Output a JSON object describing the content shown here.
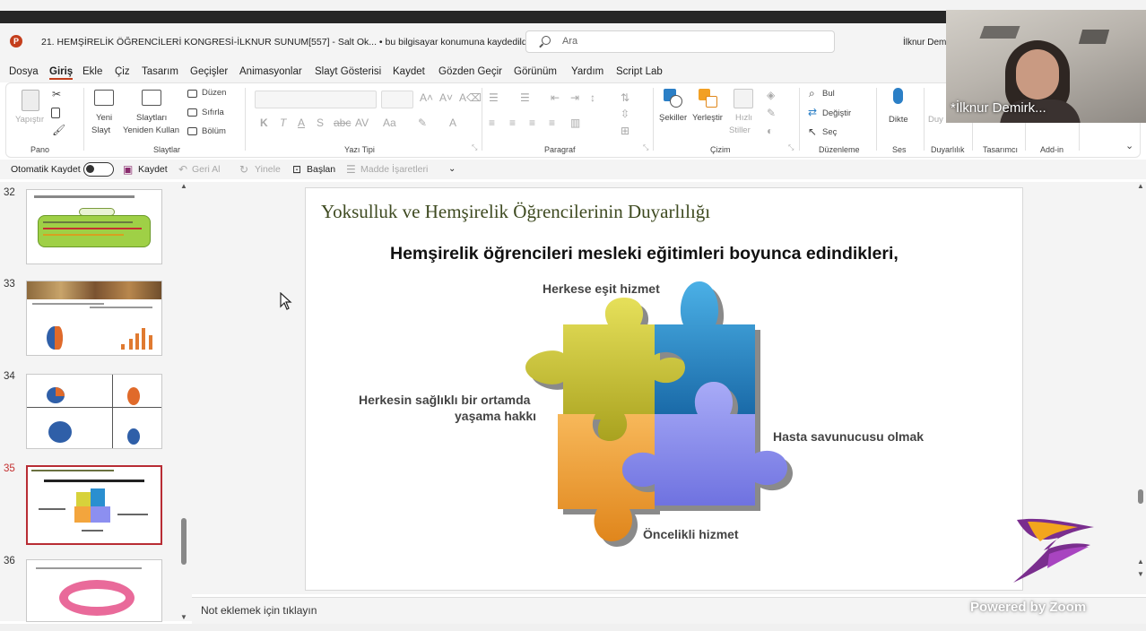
{
  "window": {
    "title": "21. HEMŞİRELİK ÖĞRENCİLERİ KONGRESİ-İLKNUR SUNUM[557]  -  Salt Ok...  •  bu bilgisayar konumuna kaydedildi",
    "search_placeholder": "Ara",
    "user": "İlknur Dem"
  },
  "menu": [
    "Dosya",
    "Giriş",
    "Ekle",
    "Çiz",
    "Tasarım",
    "Geçişler",
    "Animasyonlar",
    "Slayt Gösterisi",
    "Kaydet",
    "Gözden Geçir",
    "Görünüm",
    "Yardım",
    "Script Lab"
  ],
  "ribbon": {
    "groups": [
      "Pano",
      "Slaytlar",
      "Yazı Tipi",
      "Paragraf",
      "Çizim",
      "Düzenleme",
      "Ses",
      "Duyarlılık",
      "Tasarımcı",
      "Add-in"
    ],
    "paste": "Yapıştır",
    "new_slide_1": "Yeni",
    "new_slide_2": "Slayt",
    "reuse_1": "Slaytları",
    "reuse_2": "Yeniden Kullan",
    "layout": "Düzen",
    "reset": "Sıfırla",
    "section": "Bölüm",
    "shapes": "Şekiller",
    "arrange": "Yerleştir",
    "quick_styles_1": "Hızlı",
    "quick_styles_2": "Stiller",
    "find": "Bul",
    "replace": "Değiştir",
    "select": "Seç",
    "dictate": "Dikte",
    "sensitivity_short": "Duy"
  },
  "qat": {
    "autosave": "Otomatik Kaydet",
    "save": "Kaydet",
    "undo": "Geri Al",
    "redo": "Yinele",
    "from_start": "Başlan",
    "bullets": "Madde İşaretleri"
  },
  "thumbnails": [
    {
      "num": "32"
    },
    {
      "num": "33"
    },
    {
      "num": "34"
    },
    {
      "num": "35"
    },
    {
      "num": "36"
    }
  ],
  "slide": {
    "title": "Yoksulluk ve Hemşirelik Öğrencilerinin Duyarlılığı",
    "subtitle": "Hemşirelik öğrencileri mesleki eğitimleri boyunca edindikleri,",
    "labels": {
      "top": "Herkese eşit hizmet",
      "left_1": "Herkesin sağlıklı bir ortamda",
      "left_2": "yaşama hakkı",
      "right": "Hasta savunucusu olmak",
      "bottom": "Öncelikli hizmet"
    }
  },
  "notes_placeholder": "Not eklemek için tıklayın",
  "video": {
    "participant": "*İlknur Demirk...",
    "brand": "Powered by Zoom"
  },
  "colors": {
    "accent": "#c43e1c",
    "puzzle_yellow": "#d7d23b",
    "puzzle_blue": "#2a8fd0",
    "puzzle_orange": "#f3a53d",
    "puzzle_purple": "#8c8ff0",
    "active_thumb_border": "#b82c34"
  }
}
